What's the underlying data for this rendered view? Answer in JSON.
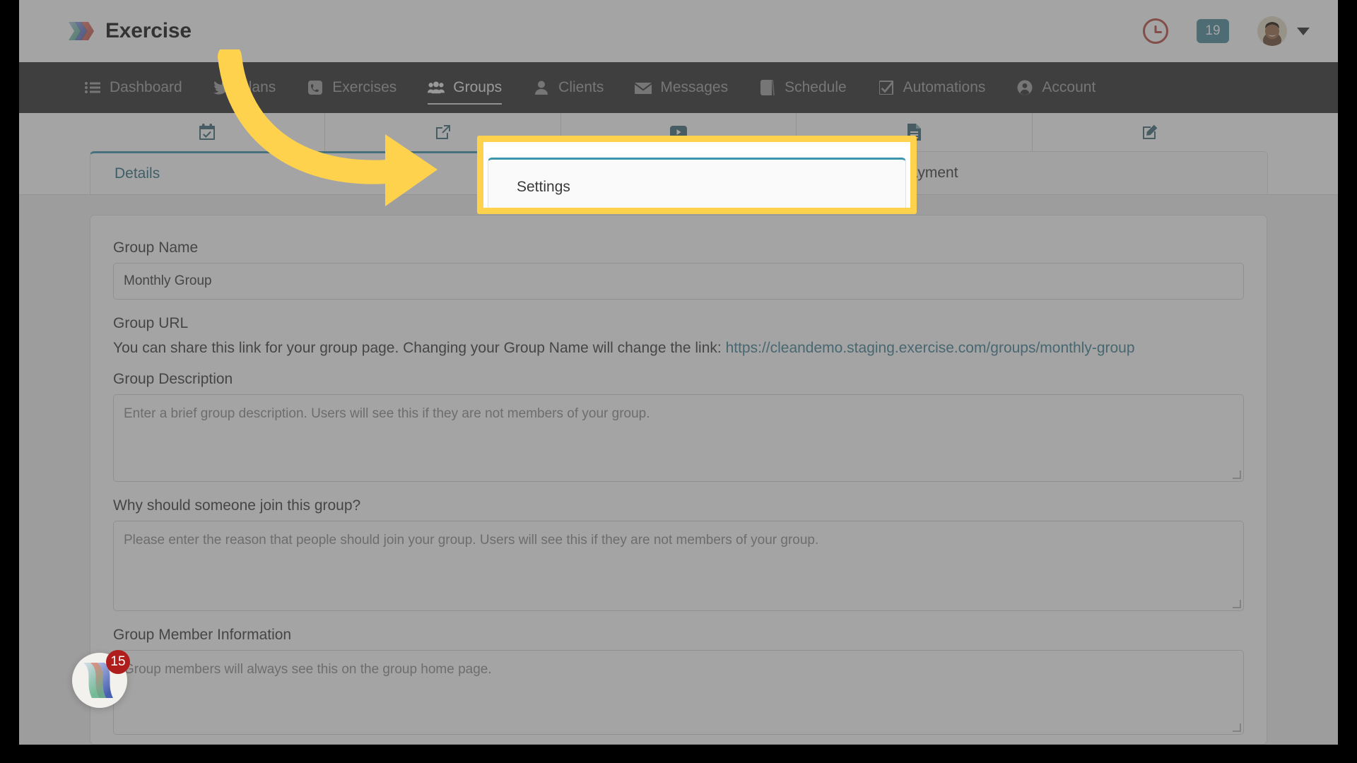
{
  "header": {
    "brand": "Exercise",
    "logo_icon": "exercise-chevron-logo",
    "clock_icon": "clock-icon",
    "clock_color": "#b64b42",
    "notification_count": "19",
    "badge_color": "#4a8a9b",
    "avatar_icon": "user-avatar",
    "chevron_icon": "chevron-down-icon"
  },
  "nav": {
    "items": [
      {
        "label": "Dashboard",
        "icon": "list-icon",
        "active": false
      },
      {
        "label": "Plans",
        "icon": "twitter-bird-icon",
        "active": false
      },
      {
        "label": "Exercises",
        "icon": "phone-icon",
        "active": false
      },
      {
        "label": "Groups",
        "icon": "people-group-icon",
        "active": true
      },
      {
        "label": "Clients",
        "icon": "person-icon",
        "active": false
      },
      {
        "label": "Messages",
        "icon": "envelope-icon",
        "active": false
      },
      {
        "label": "Schedule",
        "icon": "book-icon",
        "active": false
      },
      {
        "label": "Automations",
        "icon": "checkbox-checked-icon",
        "active": false
      },
      {
        "label": "Account",
        "icon": "user-circle-icon",
        "active": false
      }
    ]
  },
  "icon_strip": {
    "icons": [
      "calendar-check-icon",
      "external-link-icon",
      "video-play-icon",
      "document-icon",
      "edit-pencil-icon"
    ]
  },
  "tabs": [
    {
      "label": "Details",
      "active": true
    },
    {
      "label": "Settings",
      "active": false
    },
    {
      "label": "Payment",
      "active": false
    }
  ],
  "highlight": {
    "tab_label": "Settings",
    "border_color": "#ffd24d",
    "arrow_icon": "curved-arrow-icon"
  },
  "form": {
    "group_name": {
      "label": "Group Name",
      "value": "Monthly Group"
    },
    "group_url": {
      "label": "Group URL",
      "helper_prefix": "You can share this link for your group page. Changing your Group Name will change the link:",
      "link": "https://cleandemo.staging.exercise.com/groups/monthly-group",
      "link_color": "#3d7f94"
    },
    "group_description": {
      "label": "Group Description",
      "placeholder": "Enter a brief group description.  Users will see this if they are not members of your group."
    },
    "join_reason": {
      "label": "Why should someone join this group?",
      "placeholder": "Please enter the reason that people should join your group.  Users will see this if they are not members of your group."
    },
    "member_info": {
      "label": "Group Member Information",
      "placeholder": "Group members will always see this on the group home page."
    }
  },
  "chat_widget": {
    "icon": "exercise-chevron-logo",
    "badge": "15",
    "badge_color": "#b01d1d"
  }
}
